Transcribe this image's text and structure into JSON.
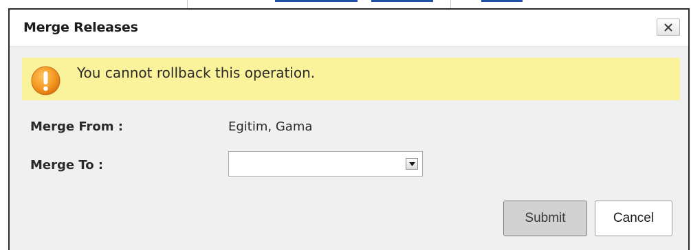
{
  "dialog": {
    "title": "Merge Releases",
    "close_label": "×"
  },
  "warning": {
    "text": "You cannot rollback this operation.",
    "icon": "warning-exclamation-icon",
    "background_color": "#fbf39c",
    "icon_color": "#f08a1c"
  },
  "form": {
    "merge_from_label": "Merge From :",
    "merge_from_value": "Egitim, Gama",
    "merge_to_label": "Merge To :",
    "merge_to_selected": ""
  },
  "buttons": {
    "submit_label": "Submit",
    "cancel_label": "Cancel"
  }
}
